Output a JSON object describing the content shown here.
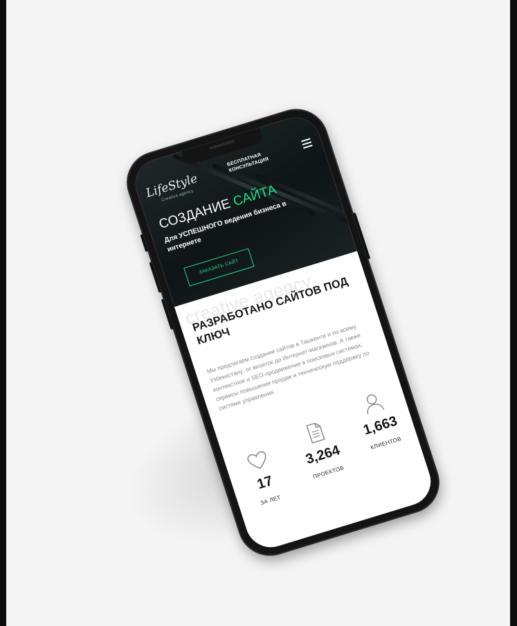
{
  "nav": {
    "logo": "LifeStyle",
    "logo_sub": "Creative agency",
    "consult_line1": "БЕСПЛАТНАЯ",
    "consult_line2": "КОНСУЛЬТАЦИЯ",
    "menu_icon": "hamburger-icon"
  },
  "hero": {
    "title_main": "СОЗДАНИЕ ",
    "title_accent": "САЙТА",
    "subtitle": "Для УСПЕШНОГО ведения бизнеса в интернете",
    "cta_label": "ЗАКАЗАТЬ САЙТ"
  },
  "about": {
    "watermark": "creative agency",
    "title": "РАЗРАБОТАНО САЙТОВ ПОД КЛЮЧ",
    "description": "Мы предлагаем создание сайтов в Ташкенте и по всему Узбекистану: от визиток до Интернет-магазинов. А также контекстное и SEO-продвижение в поисковых системах, сервисы повышения продаж и техническую поддержку по системе управления."
  },
  "stats": [
    {
      "icon": "heart-icon",
      "value": "17",
      "label": "ЗА ЛЕТ"
    },
    {
      "icon": "document-icon",
      "value": "3,264",
      "label": "ПРОЕКТОВ"
    },
    {
      "icon": "user-icon",
      "value": "1,663",
      "label": "КЛИЕНТОВ"
    }
  ],
  "colors": {
    "accent": "#1fe08a",
    "hero_bg": "#1a2223",
    "phone_body": "#141414",
    "page_bg": "#f4f4f4"
  }
}
